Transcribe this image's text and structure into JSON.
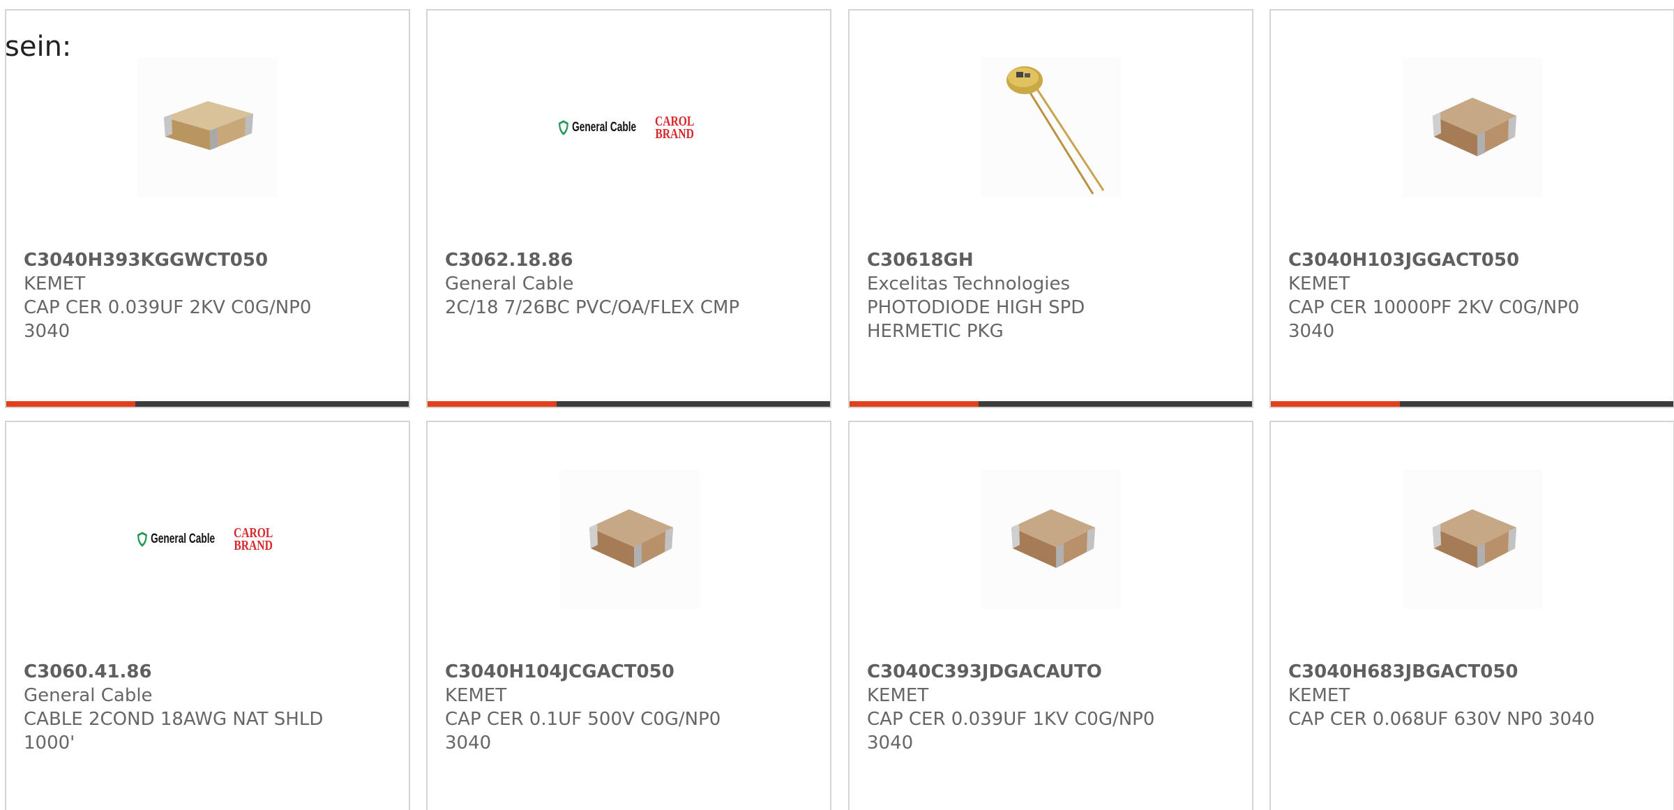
{
  "page": {
    "prefix_text": "sein:"
  },
  "colors": {
    "accent": "#e2401c",
    "progress_track": "#3c3c3c",
    "card_border": "#d4d4d4",
    "text": "#666666"
  },
  "products": [
    {
      "part_number": "C3040H393KGGWCT050",
      "manufacturer": "KEMET",
      "description": "CAP CER 0.039UF 2KV C0G/NP0 3040",
      "image_icon": "ceramic-capacitor-icon",
      "progress": 0.32
    },
    {
      "part_number": "C3062.18.86",
      "manufacturer": "General Cable",
      "description": "2C/18 7/26BC PVC/OA/FLEX CMP",
      "image_icon": "general-cable-logo",
      "progress": 0.32
    },
    {
      "part_number": "C30618GH",
      "manufacturer": "Excelitas Technologies",
      "description": "PHOTODIODE HIGH SPD HERMETIC PKG",
      "image_icon": "photodiode-icon",
      "progress": 0.32
    },
    {
      "part_number": "C3040H103JGGACT050",
      "manufacturer": "KEMET",
      "description": "CAP CER 10000PF 2KV C0G/NP0 3040",
      "image_icon": "ceramic-capacitor-icon",
      "progress": 0.32
    },
    {
      "part_number": "C3060.41.86",
      "manufacturer": "General Cable",
      "description": "CABLE 2COND 18AWG NAT SHLD 1000'",
      "image_icon": "general-cable-logo"
    },
    {
      "part_number": "C3040H104JCGACT050",
      "manufacturer": "KEMET",
      "description": "CAP CER 0.1UF 500V C0G/NP0 3040",
      "image_icon": "ceramic-capacitor-icon"
    },
    {
      "part_number": "C3040C393JDGACAUTO",
      "manufacturer": "KEMET",
      "description": "CAP CER 0.039UF 1KV C0G/NP0 3040",
      "image_icon": "ceramic-capacitor-icon"
    },
    {
      "part_number": "C3040H683JBGACT050",
      "manufacturer": "KEMET",
      "description": "CAP CER 0.068UF 630V NP0 3040",
      "image_icon": "ceramic-capacitor-icon"
    }
  ],
  "logo": {
    "general_cable_text": "General Cable",
    "carol_line1": "CAROL",
    "carol_line2": "BRAND"
  }
}
